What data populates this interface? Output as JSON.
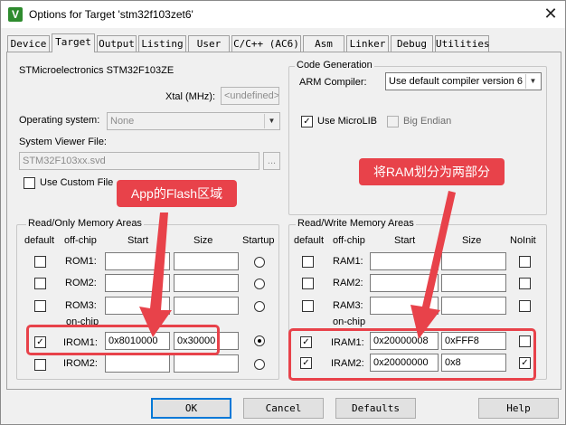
{
  "window": {
    "title": "Options for Target 'stm32f103zet6'",
    "icon_letter": "V"
  },
  "tabs": [
    "Device",
    "Target",
    "Output",
    "Listing",
    "User",
    "C/C++ (AC6)",
    "Asm",
    "Linker",
    "Debug",
    "Utilities"
  ],
  "target": {
    "device_name": "STMicroelectronics STM32F103ZE",
    "xtal_label": "Xtal (MHz):",
    "xtal_value": "<undefined>",
    "os_label": "Operating system:",
    "os_value": "None",
    "svf_label": "System Viewer File:",
    "svf_value": "STM32F103xx.svd",
    "browse_label": "...",
    "custom_file_label": "Use Custom File"
  },
  "codegen": {
    "title": "Code Generation",
    "compiler_label": "ARM Compiler:",
    "compiler_value": "Use default compiler version 6",
    "microlib_label": "Use MicroLIB",
    "bigendian_label": "Big Endian"
  },
  "ro": {
    "title": "Read/Only Memory Areas",
    "headers": [
      "default",
      "off-chip",
      "Start",
      "Size",
      "Startup"
    ],
    "onchip_label": "on-chip",
    "rows": [
      {
        "label": "ROM1:",
        "start": "",
        "size": "",
        "default": false,
        "startup": false
      },
      {
        "label": "ROM2:",
        "start": "",
        "size": "",
        "default": false,
        "startup": false
      },
      {
        "label": "ROM3:",
        "start": "",
        "size": "",
        "default": false,
        "startup": false
      },
      {
        "label": "IROM1:",
        "start": "0x8010000",
        "size": "0x30000",
        "default": true,
        "startup": true
      },
      {
        "label": "IROM2:",
        "start": "",
        "size": "",
        "default": false,
        "startup": false
      }
    ]
  },
  "rw": {
    "title": "Read/Write Memory Areas",
    "headers": [
      "default",
      "off-chip",
      "Start",
      "Size",
      "NoInit"
    ],
    "onchip_label": "on-chip",
    "rows": [
      {
        "label": "RAM1:",
        "start": "",
        "size": "",
        "default": false,
        "noinit": false
      },
      {
        "label": "RAM2:",
        "start": "",
        "size": "",
        "default": false,
        "noinit": false
      },
      {
        "label": "RAM3:",
        "start": "",
        "size": "",
        "default": false,
        "noinit": false
      },
      {
        "label": "IRAM1:",
        "start": "0x20000008",
        "size": "0xFFF8",
        "default": true,
        "noinit": false
      },
      {
        "label": "IRAM2:",
        "start": "0x20000000",
        "size": "0x8",
        "default": true,
        "noinit": true
      }
    ]
  },
  "annotations": {
    "left_callout": "App的Flash区域",
    "right_callout": "将RAM划分为两部分",
    "color": "#e8424a"
  },
  "buttons": {
    "ok": "OK",
    "cancel": "Cancel",
    "defaults": "Defaults",
    "help": "Help"
  }
}
